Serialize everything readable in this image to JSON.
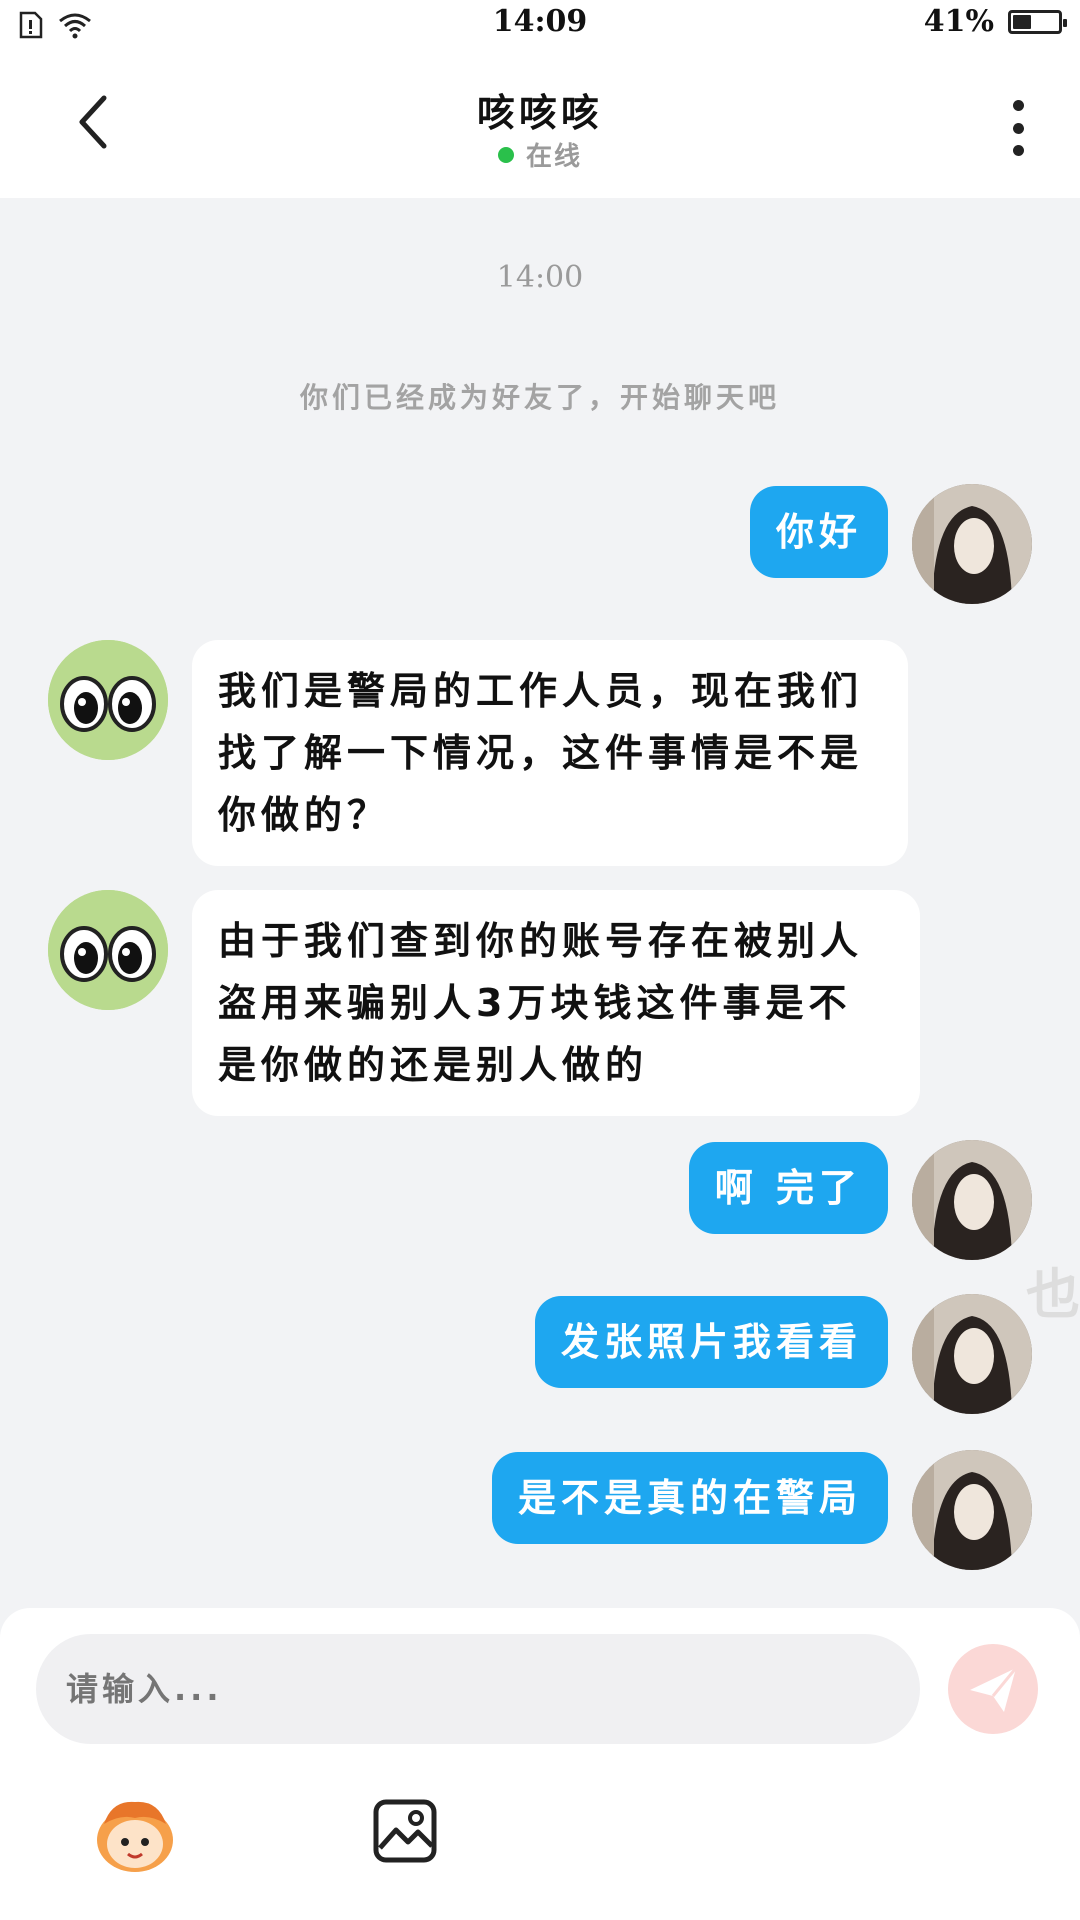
{
  "status_bar": {
    "time": "14:09",
    "battery_text": "41%",
    "battery_level": 0.41,
    "icons": [
      "sim-icon",
      "wifi-icon",
      "battery-icon"
    ]
  },
  "header": {
    "title": "咳咳咳",
    "status": "在线",
    "status_color": "#2ac04b",
    "icons": [
      "back-arrow-icon",
      "more-vertical-icon"
    ]
  },
  "chat": {
    "timestamp": "14:00",
    "system_message": "你们已经成为好友了，开始聊天吧",
    "messages": [
      {
        "from": "me",
        "text": "你好"
      },
      {
        "from": "other",
        "text": "我们是警局的工作人员，现在我们找了解一下情况，这件事情是不是你做的？"
      },
      {
        "from": "other",
        "text": "由于我们查到你的账号存在被别人盗用来骗别人3万块钱这件事是不是你做的还是别人做的"
      },
      {
        "from": "me",
        "text": "啊 完了"
      },
      {
        "from": "me",
        "text": "发张照片我看看"
      },
      {
        "from": "me",
        "text": "是不是真的在警局"
      }
    ],
    "edge_text": "也"
  },
  "input": {
    "placeholder": "请输入...",
    "value": "",
    "icons": [
      "send-icon",
      "emoji-icon",
      "image-icon"
    ]
  },
  "colors": {
    "outgoing_bubble": "#1ea7f0",
    "incoming_bubble": "#ffffff",
    "background": "#f2f3f5"
  }
}
